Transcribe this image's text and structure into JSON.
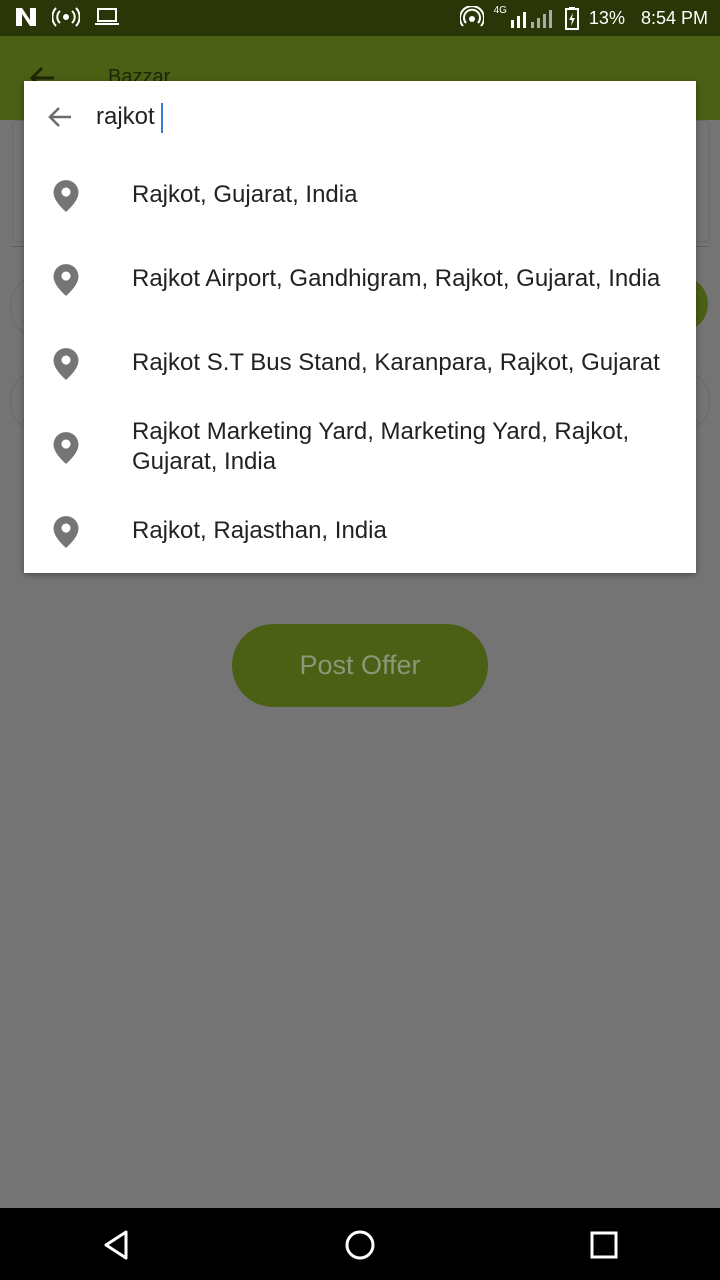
{
  "status_bar": {
    "battery": "13%",
    "time": "8:54 PM",
    "network": "4G",
    "icons": [
      "n-logo-icon",
      "hotspot-icon",
      "laptop-icon",
      "wifi-hotspot-icon",
      "signal-icon",
      "battery-icon"
    ]
  },
  "app_bar": {
    "title": "Bazzar"
  },
  "search": {
    "query": "rajkot"
  },
  "results": [
    {
      "label": "Rajkot, Gujarat, India"
    },
    {
      "label": "Rajkot Airport, Gandhigram, Rajkot, Gujarat, India"
    },
    {
      "label": "Rajkot S.T Bus Stand, Karanpara, Rajkot, Gujarat"
    },
    {
      "label": "Rajkot Marketing Yard, Marketing Yard, Rajkot, Gujarat, India"
    },
    {
      "label": "Rajkot, Rajasthan, India"
    }
  ],
  "main": {
    "post_offer_label": "Post Offer"
  },
  "colors": {
    "primary": "#4b5f15",
    "status_bar": "#2a3608",
    "scrim": "#747474"
  }
}
